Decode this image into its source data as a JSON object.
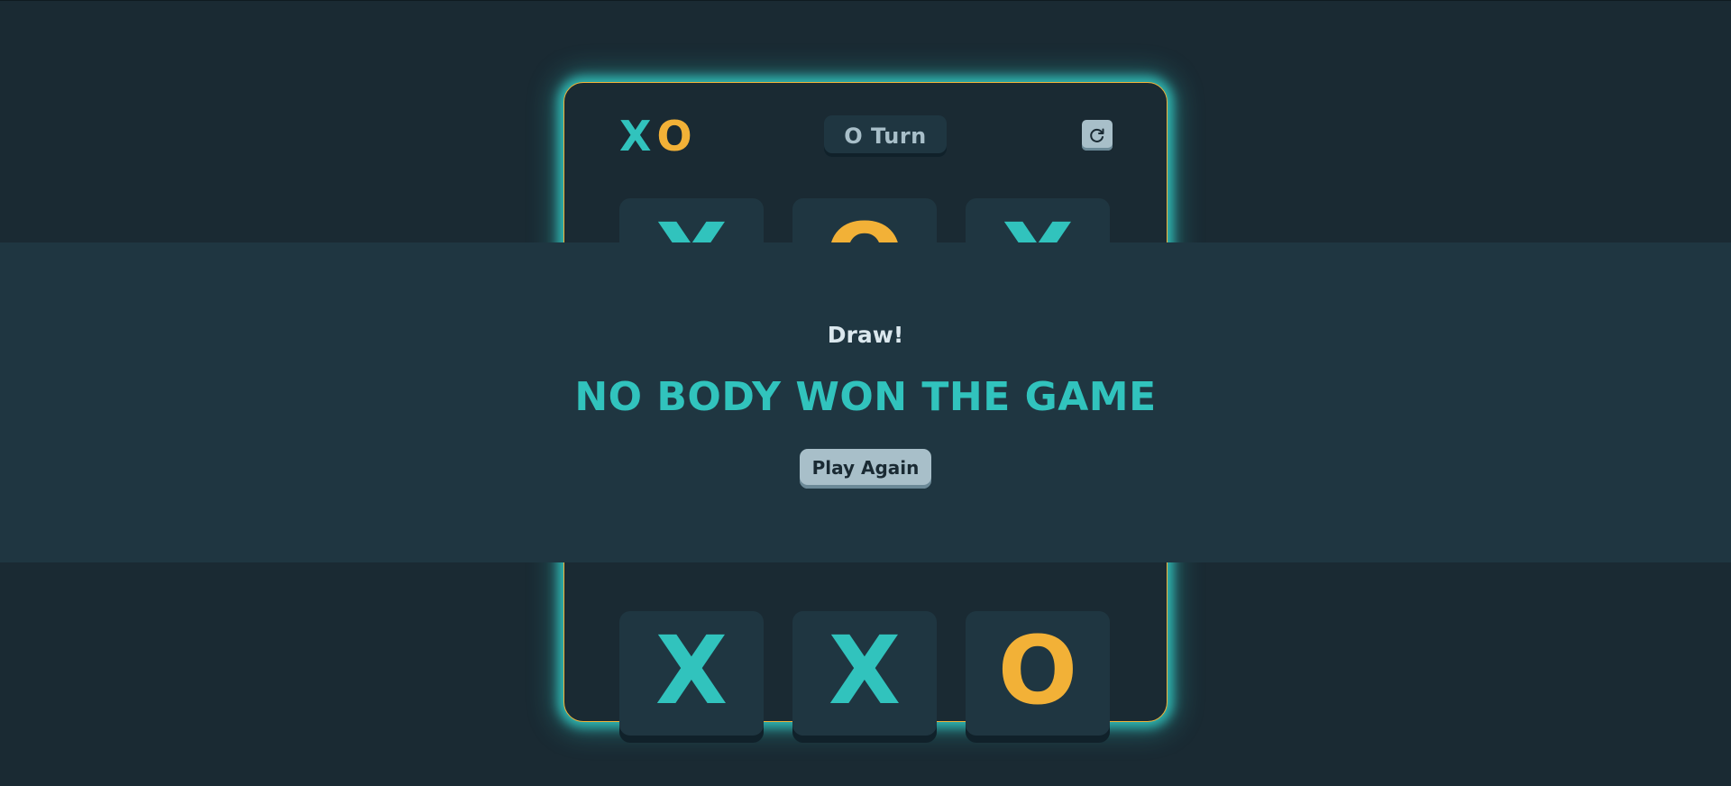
{
  "logo": {
    "x": "X",
    "o": "O"
  },
  "turn_indicator": "O Turn",
  "restart_icon": "restart-icon",
  "board": {
    "cells": [
      "X",
      "O",
      "X",
      "",
      "",
      "",
      "X",
      "X",
      "O"
    ]
  },
  "result": {
    "label": "Draw!",
    "title": "NO BODY WON THE GAME",
    "play_again_label": "Play Again"
  },
  "colors": {
    "x": "#31c3bd",
    "o": "#f2b137",
    "background": "#1a2a33",
    "tile": "#1f3641",
    "silver": "#a8bfc9"
  }
}
